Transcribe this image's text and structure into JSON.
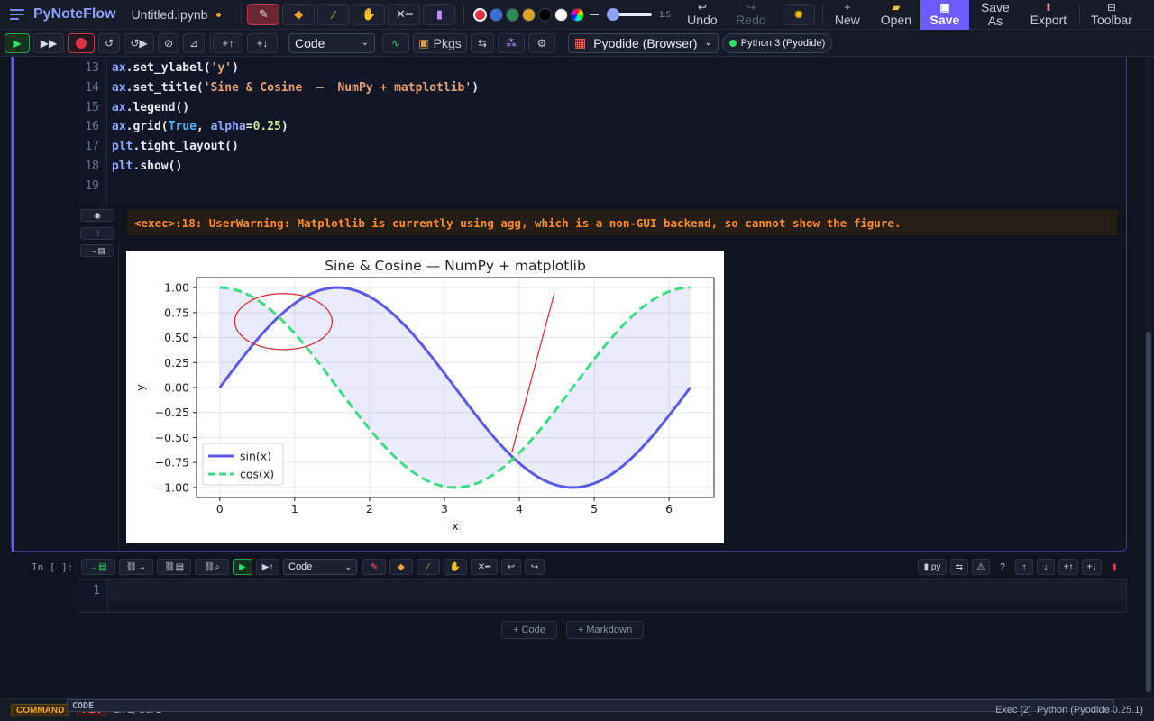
{
  "app": {
    "name": "PyNoteFlow",
    "filename": "Untitled.ipynb"
  },
  "toolbar": {
    "stroke_width": "1.5",
    "undo_label": "Undo",
    "redo_label": "Redo",
    "new_label": "New",
    "open_label": "Open",
    "save_label": "Save",
    "save_as_label": "Save As",
    "export_label": "Export",
    "toolbar_label": "Toolbar",
    "colors": [
      "#e0334a",
      "#3b6fd6",
      "#2e8b57",
      "#e0a020",
      "#000000",
      "#ffffff"
    ]
  },
  "runbar": {
    "cell_type": "Code",
    "pkgs_label": "Pkgs",
    "kernel": "Pyodide (Browser)",
    "kernel_status": "Python 3 (Pyodide)"
  },
  "cell1": {
    "lines": [
      {
        "n": "13",
        "parts": [
          [
            "obj",
            "ax"
          ],
          [
            "",
            "."
          ],
          [
            "",
            "set_ylabel("
          ],
          [
            "str",
            "'y'"
          ],
          [
            "",
            ")"
          ]
        ]
      },
      {
        "n": "14",
        "parts": [
          [
            "obj",
            "ax"
          ],
          [
            "",
            "."
          ],
          [
            "",
            "set_title("
          ],
          [
            "str",
            "'Sine & Cosine  —  NumPy + matplotlib'"
          ],
          [
            "",
            ")"
          ]
        ]
      },
      {
        "n": "15",
        "parts": [
          [
            "obj",
            "ax"
          ],
          [
            "",
            "."
          ],
          [
            "",
            "legend()"
          ]
        ]
      },
      {
        "n": "16",
        "parts": [
          [
            "obj",
            "ax"
          ],
          [
            "",
            "."
          ],
          [
            "",
            "grid("
          ],
          [
            "kw",
            "True"
          ],
          [
            "",
            ", "
          ],
          [
            "obj",
            "alpha"
          ],
          [
            "",
            "="
          ],
          [
            "num",
            "0.25"
          ],
          [
            "",
            ")"
          ]
        ]
      },
      {
        "n": "17",
        "parts": [
          [
            "obj",
            "plt"
          ],
          [
            "",
            "."
          ],
          [
            "",
            "tight_layout()"
          ]
        ]
      },
      {
        "n": "18",
        "parts": [
          [
            "obj",
            "plt"
          ],
          [
            "",
            "."
          ],
          [
            "",
            "show()"
          ]
        ]
      },
      {
        "n": "19",
        "parts": []
      }
    ],
    "warning": "<exec>:18: UserWarning: Matplotlib is currently using agg, which is a non-GUI backend, so cannot show the figure."
  },
  "chart_data": {
    "type": "line",
    "title": "Sine & Cosine  —  NumPy + matplotlib",
    "xlabel": "x",
    "ylabel": "y",
    "xlim": [
      -0.31,
      6.6
    ],
    "ylim": [
      -1.1,
      1.1
    ],
    "xticks": [
      "0",
      "1",
      "2",
      "3",
      "4",
      "5",
      "6"
    ],
    "yticks": [
      "1.00",
      "0.75",
      "0.50",
      "0.25",
      "0.00",
      "−0.25",
      "−0.50",
      "−0.75",
      "−1.00"
    ],
    "grid": true,
    "legend_position": "lower left",
    "fill_between": true,
    "series": [
      {
        "name": "sin(x)",
        "color": "#5a5ae6",
        "style": "solid",
        "x_range": [
          0,
          6.283
        ],
        "fn": "sin"
      },
      {
        "name": "cos(x)",
        "color": "#3ddc84",
        "style": "dashed",
        "x_range": [
          0,
          6.283
        ],
        "fn": "cos"
      }
    ],
    "annotations": [
      {
        "type": "ellipse",
        "color": "#d62728",
        "cx": 0.85,
        "cy": 0.66,
        "rx": 0.65,
        "ry": 0.28
      },
      {
        "type": "line",
        "color": "#d62728",
        "x1": 3.9,
        "y1": -0.65,
        "x2": 4.47,
        "y2": 0.95
      }
    ]
  },
  "cell2": {
    "prompt": "In [ ]:",
    "cell_type": "Code",
    "ext_label": ".py",
    "line_number": "1"
  },
  "add": {
    "code": "+ Code",
    "markdown": "+ Markdown"
  },
  "status": {
    "mode": "COMMAND",
    "pen": "PEN",
    "cell": "CODE",
    "position": "Ln 1, Col 1",
    "exec": "Exec [2]",
    "runtime": "Python (Pyodide 0.25.1)"
  }
}
